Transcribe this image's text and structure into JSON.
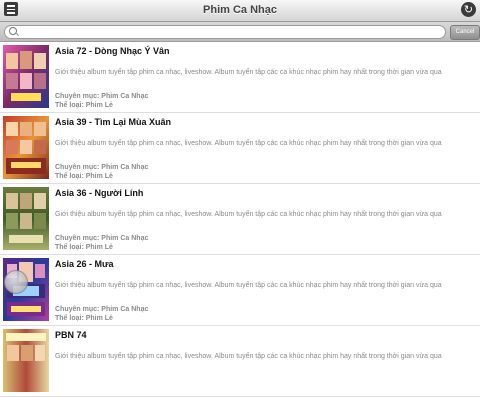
{
  "header": {
    "title": "Phim Ca Nhạc"
  },
  "search": {
    "placeholder": "",
    "value": "",
    "cancel_label": "Cancel"
  },
  "items": [
    {
      "title": "Asia 72 - Dòng Nhạc Ý Vân",
      "description": "Giới thiệu album tuyển tập phim ca nhạc, liveshow. Album tuyển tập các ca khúc nhạc phim hay nhất trong thời gian vừa qua",
      "category": "Chuyên mục: Phim Ca Nhạc",
      "genre": "Thể loại: Phim Lẻ"
    },
    {
      "title": "Asia 39 - Tìm Lại Mùa Xuân",
      "description": "Giới thiệu album tuyển tập phim ca nhạc, liveshow. Album tuyển tập các ca khúc nhạc phim hay nhất trong thời gian vừa qua",
      "category": "Chuyên mục: Phim Ca Nhạc",
      "genre": "Thể loại: Phim Lẻ"
    },
    {
      "title": "Asia 36 - Người Lính",
      "description": "Giới thiệu album tuyển tập phim ca nhạc, liveshow. Album tuyển tập các ca khúc nhạc phim hay nhất trong thời gian vừa qua",
      "category": "Chuyên mục: Phim Ca Nhạc",
      "genre": "Thể loại: Phim Lẻ"
    },
    {
      "title": "Asia 26 - Mưa",
      "description": "Giới thiệu album tuyển tập phim ca nhạc, liveshow. Album tuyển tập các ca khúc nhạc phim hay nhất trong thời gian vừa qua",
      "category": "Chuyên mục: Phim Ca Nhạc",
      "genre": "Thể loại: Phim Lẻ"
    },
    {
      "title": "PBN 74",
      "description": "Giới thiệu album tuyển tập phim ca nhạc, liveshow. Album tuyển tập các ca khúc nhạc phim hay nhất trong thời gian vừa qua",
      "category": "",
      "genre": ""
    }
  ],
  "icons": {
    "menu": "menu-icon",
    "refresh": "refresh-icon",
    "search": "search-icon"
  },
  "colors": {
    "bar": "#d4d4d4",
    "title": "#111111",
    "secondary": "#8a8a8a"
  }
}
